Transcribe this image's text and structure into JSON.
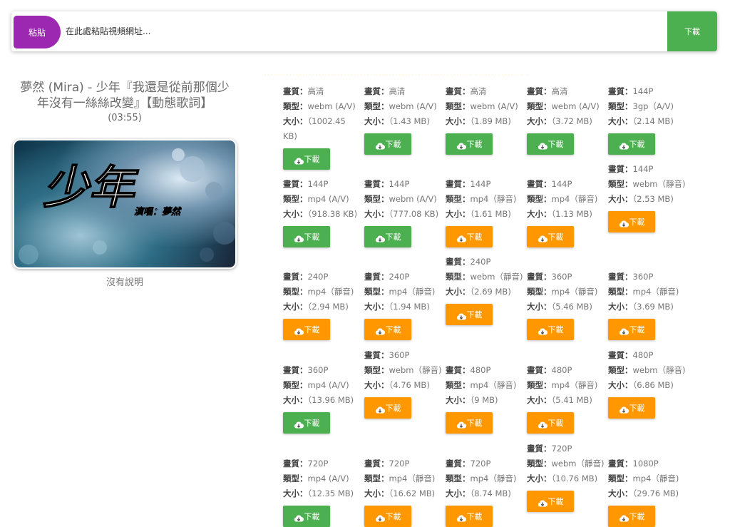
{
  "topbar": {
    "paste_label": "粘貼",
    "url_placeholder": "在此處粘貼視頻網址...",
    "download_label": "下載"
  },
  "video": {
    "title": "夢然 (Mira) - 少年『我還是從前那個少年沒有一絲絲改變』【動態歌詞】",
    "duration": "(03:55)",
    "thumbnail_text": "少年",
    "thumbnail_sub": "演唱：夢然",
    "no_description": "沒有說明"
  },
  "labels": {
    "quality": "畫質：",
    "type": "類型：",
    "size": "大小："
  },
  "colors": {
    "green": "#4caf50",
    "orange": "#ff9800",
    "purple": "#9c27b0"
  },
  "formats": [
    {
      "quality": "高清",
      "type": "webm (A/V)",
      "size": "（1002.45 KB)",
      "button": "下載",
      "color": "green"
    },
    {
      "quality": "高清",
      "type": "webm (A/V)",
      "size": "（1.43 MB)",
      "button": "下載",
      "color": "green"
    },
    {
      "quality": "高清",
      "type": "webm (A/V)",
      "size": "（1.89 MB)",
      "button": "下載",
      "color": "green"
    },
    {
      "quality": "高清",
      "type": "webm (A/V)",
      "size": "（3.72 MB)",
      "button": "下載",
      "color": "green"
    },
    {
      "quality": "144P",
      "type": "3gp（A/V)",
      "size": "（2.14 MB)",
      "button": "下載",
      "color": "green"
    },
    {
      "quality": "144P",
      "type": "mp4 (A/V)",
      "size": "（918.38 KB)",
      "button": "下載",
      "color": "green"
    },
    {
      "quality": "144P",
      "type": "webm (A/V)",
      "size": "（777.08 KB)",
      "button": "下載",
      "color": "green"
    },
    {
      "quality": "144P",
      "type": "mp4（靜音)",
      "size": "（1.61 MB)",
      "button": "下載",
      "color": "orange"
    },
    {
      "quality": "144P",
      "type": "mp4（靜音)",
      "size": "（1.13 MB)",
      "button": "下載",
      "color": "orange"
    },
    {
      "quality": "144P",
      "type": "webm（靜音)",
      "size": "（2.53 MB)",
      "button": "下載",
      "color": "orange"
    },
    {
      "quality": "240P",
      "type": "mp4（靜音)",
      "size": "（2.94 MB)",
      "button": "下載",
      "color": "orange"
    },
    {
      "quality": "240P",
      "type": "mp4（靜音)",
      "size": "（1.94 MB)",
      "button": "下載",
      "color": "orange"
    },
    {
      "quality": "240P",
      "type": "webm（靜音)",
      "size": "（2.69 MB)",
      "button": "下載",
      "color": "orange"
    },
    {
      "quality": "360P",
      "type": "mp4（靜音)",
      "size": "（5.46 MB)",
      "button": "下載",
      "color": "orange"
    },
    {
      "quality": "360P",
      "type": "mp4（靜音)",
      "size": "（3.69 MB)",
      "button": "下載",
      "color": "orange"
    },
    {
      "quality": "360P",
      "type": "mp4 (A/V)",
      "size": "（13.96 MB)",
      "button": "下載",
      "color": "green"
    },
    {
      "quality": "360P",
      "type": "webm（靜音)",
      "size": "（4.76 MB)",
      "button": "下載",
      "color": "orange"
    },
    {
      "quality": "480P",
      "type": "mp4（靜音)",
      "size": "（9 MB)",
      "button": "下載",
      "color": "orange"
    },
    {
      "quality": "480P",
      "type": "mp4（靜音)",
      "size": "（5.41 MB)",
      "button": "下載",
      "color": "orange"
    },
    {
      "quality": "480P",
      "type": "webm（靜音)",
      "size": "（6.86 MB)",
      "button": "下載",
      "color": "orange"
    },
    {
      "quality": "720P",
      "type": "mp4 (A/V)",
      "size": "（12.35 MB)",
      "button": "下載",
      "color": "green"
    },
    {
      "quality": "720P",
      "type": "mp4（靜音)",
      "size": "（16.62 MB)",
      "button": "下載",
      "color": "orange"
    },
    {
      "quality": "720P",
      "type": "mp4（靜音)",
      "size": "（8.74 MB)",
      "button": "下載",
      "color": "orange"
    },
    {
      "quality": "720P",
      "type": "webm（靜音)",
      "size": "（10.76 MB)",
      "button": "下載",
      "color": "orange"
    },
    {
      "quality": "1080P",
      "type": "mp4（靜音)",
      "size": "（29.76 MB)",
      "button": "下載",
      "color": "orange"
    }
  ]
}
